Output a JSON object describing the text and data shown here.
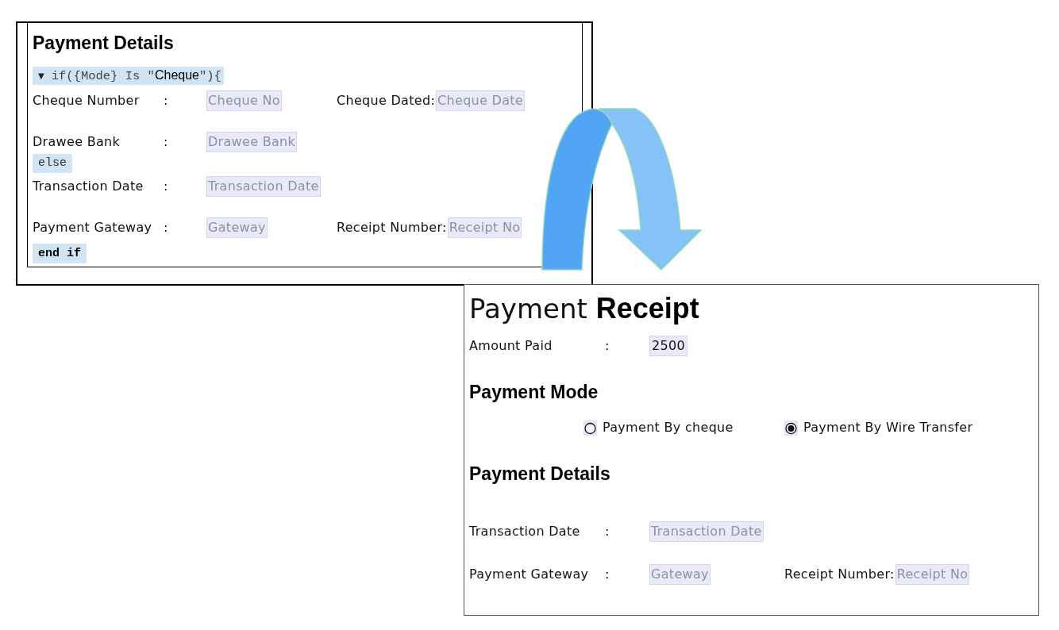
{
  "form_designer": {
    "title": "Payment Details",
    "blocks": [
      {
        "kind": "condition",
        "toggle": "▼",
        "code_before": "if({Mode} Is \"",
        "value": "Cheque",
        "code_after": "\"){"
      },
      {
        "kind": "row",
        "fields": [
          {
            "label": "Cheque Number",
            "colon": ":",
            "placeholder": "Cheque No"
          },
          {
            "label": "Cheque Dated:",
            "placeholder": "Cheque Date"
          }
        ]
      },
      {
        "kind": "row",
        "fields": [
          {
            "label": "Drawee Bank",
            "colon": ":",
            "placeholder": "Drawee Bank"
          }
        ]
      },
      {
        "kind": "else",
        "text": "else"
      },
      {
        "kind": "row",
        "fields": [
          {
            "label": "Transaction Date",
            "colon": ":",
            "placeholder": "Transaction Date"
          }
        ]
      },
      {
        "kind": "row",
        "fields": [
          {
            "label": "Payment Gateway",
            "colon": ":",
            "placeholder": "Gateway"
          },
          {
            "label": "Receipt Number:",
            "placeholder": "Receipt No"
          }
        ]
      },
      {
        "kind": "end",
        "text": "end if"
      }
    ]
  },
  "receipt": {
    "title": "Payment **Receipt**",
    "blocks": [
      {
        "kind": "row",
        "fields": [
          {
            "label": "Amount Paid",
            "colon": ":",
            "value": "2500"
          }
        ]
      },
      {
        "kind": "heading",
        "text": "Payment Mode"
      },
      {
        "kind": "radio_group",
        "options": [
          {
            "label": "Payment By cheque",
            "selected": false
          },
          {
            "label": "Payment By Wire Transfer",
            "selected": true
          }
        ]
      },
      {
        "kind": "heading",
        "text": "Payment Details"
      },
      {
        "kind": "row",
        "fields": [
          {
            "label": "Transaction Date",
            "colon": ":",
            "placeholder": "Transaction Date"
          }
        ]
      },
      {
        "kind": "row",
        "fields": [
          {
            "label": "Payment Gateway",
            "colon": ":",
            "placeholder": "Gateway"
          },
          {
            "label": "Receipt Number:",
            "placeholder": "Receipt No"
          }
        ]
      }
    ]
  }
}
